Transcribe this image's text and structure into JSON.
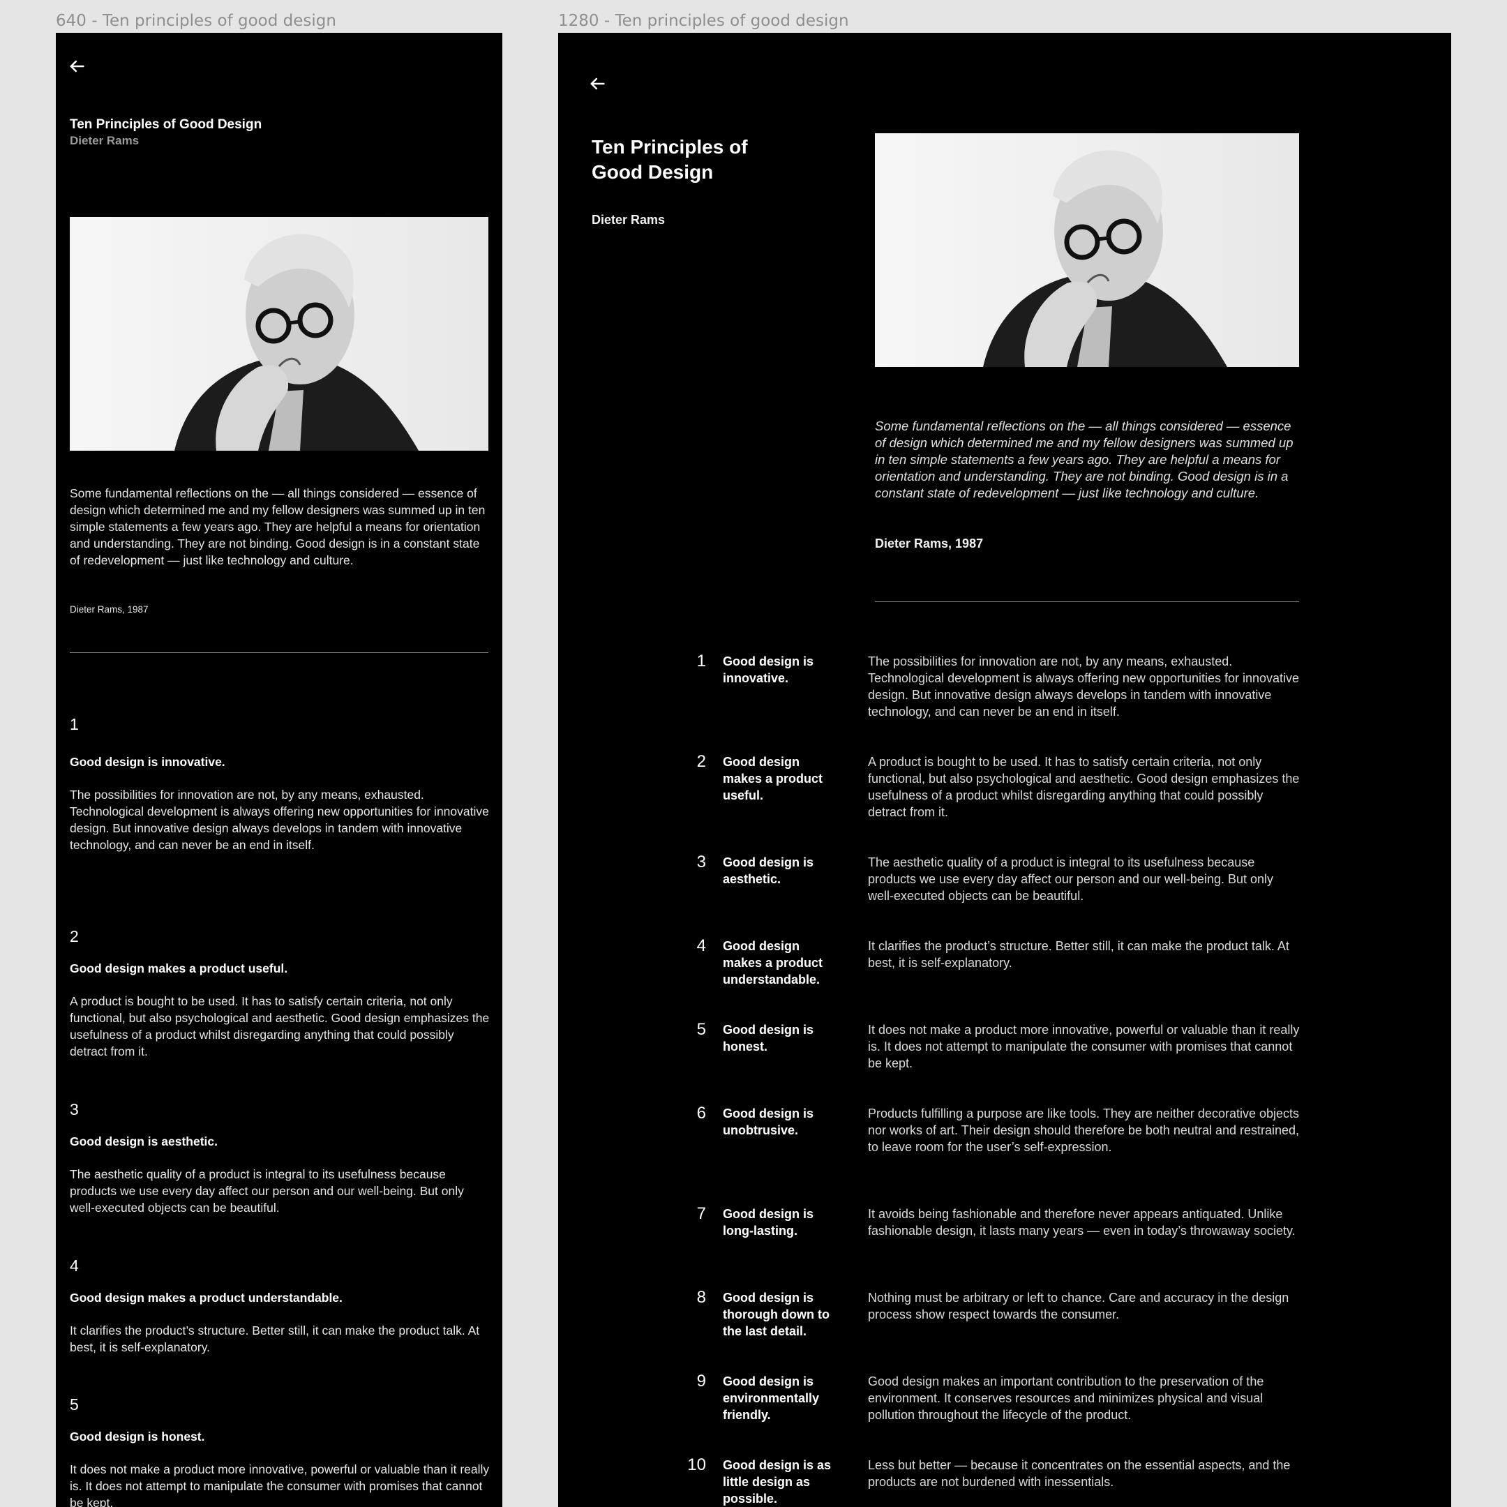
{
  "frames": {
    "mobile_label": "640 - Ten principles of good design",
    "desktop_label": "1280 - Ten principles of good design"
  },
  "article": {
    "title": "Ten Principles of Good Design",
    "title_line1": "Ten Principles of",
    "title_line2": "Good Design",
    "author": "Dieter Rams",
    "quote": "Some fundamental reflections on the — all things considered — essence of design which determined me and my fellow designers was summed up in ten simple statements a few years ago. They are helpful a means for orientation and understanding. They are not binding. Good design is in a constant state of redevelopment — just like technology and culture.",
    "signature": "Dieter Rams, 1987"
  },
  "principles": [
    {
      "num": "1",
      "head": "Good design is innovative.",
      "body": "The possibilities for innovation are not, by any means, exhausted. Technological development is always offering new opportunities for innovative design. But innovative design always develops in tandem with innovative technology, and can never be an end in itself."
    },
    {
      "num": "2",
      "head": "Good design makes a product useful.",
      "body": "A product is bought to be used. It has to satisfy certain criteria, not only functional, but also psychological and aesthetic. Good design emphasizes the usefulness of a product whilst disregarding anything that could possibly detract from it."
    },
    {
      "num": "3",
      "head": "Good design is aesthetic.",
      "body": "The aesthetic quality of a product is integral to its usefulness because products we use every day affect our person and our well-being. But only well-executed objects can be beautiful."
    },
    {
      "num": "4",
      "head": "Good design makes a product understandable.",
      "body": "It clarifies the product’s structure. Better still, it can make the product talk. At best, it is self-explanatory."
    },
    {
      "num": "5",
      "head": "Good design is honest.",
      "body": "It does not make a product more innovative, powerful or valuable than it really is. It does not attempt to manipulate the consumer with promises that cannot be kept."
    },
    {
      "num": "6",
      "head": "Good design is unobtrusive.",
      "body": "Products fulfilling a purpose are like tools. They are neither decorative objects nor works of art. Their design should therefore be both neutral and restrained, to leave room for the user’s self-expression."
    },
    {
      "num": "7",
      "head": "Good design is long-lasting.",
      "body": "It avoids being fashionable and therefore never appears antiquated. Unlike fashionable design, it lasts many years — even in today’s throwaway society."
    },
    {
      "num": "8",
      "head": "Good design is thorough down to the last detail.",
      "body": "Nothing must be arbitrary or left to chance. Care and accuracy in the design process show respect towards the consumer."
    },
    {
      "num": "9",
      "head": "Good design is environmentally friendly.",
      "body": "Good design makes an important contribution to the preservation of the environment. It conserves resources and minimizes physical and visual pollution throughout the lifecycle of the product."
    },
    {
      "num": "10",
      "head": "Good design is as little design as possible.",
      "body": "Less but better — because it concentrates on the essential aspects, and the products are not burdened with inessentials."
    }
  ],
  "icons": {
    "back": "back-arrow-icon",
    "photo": "portrait-photo"
  },
  "colors": {
    "canvas": "#e5e5e5",
    "frame": "#000000",
    "text": "#ffffff",
    "muted": "#9a9a9a"
  }
}
